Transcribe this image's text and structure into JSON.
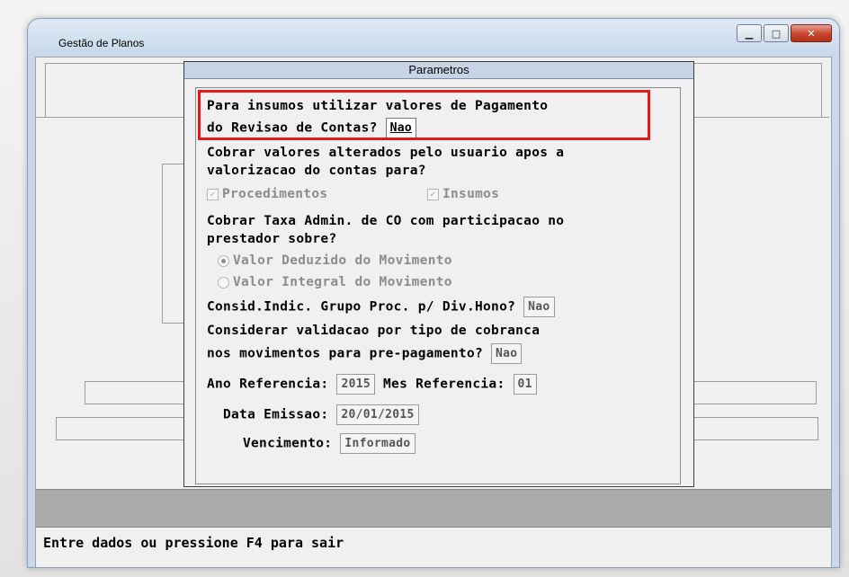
{
  "window": {
    "title": "Gestão de Planos"
  },
  "dialog": {
    "title": "Parametros",
    "q1_line1": "Para insumos utilizar valores de Pagamento",
    "q1_line2": "do Revisao de Contas?",
    "q1_value": "Nao",
    "q2_line1": "Cobrar valores alterados pelo usuario apos a",
    "q2_line2": "valorizacao do contas para?",
    "check_procedimentos": "Procedimentos",
    "check_insumos": "Insumos",
    "q3_line1": "Cobrar Taxa Admin. de CO com participacao no",
    "q3_line2": "prestador sobre?",
    "radio_deduzido": "Valor Deduzido do Movimento",
    "radio_integral": "Valor Integral do Movimento",
    "q4_label": "Consid.Indic. Grupo Proc. p/ Div.Hono?",
    "q4_value": "Nao",
    "q5_line1": "Considerar validacao por tipo de cobranca",
    "q5_line2": "nos movimentos para pre-pagamento?",
    "q5_value": "Nao",
    "ano_label": "Ano Referencia:",
    "ano_value": "2015",
    "mes_label": "Mes Referencia:",
    "mes_value": "01",
    "data_label": "Data Emissao:",
    "data_value": "20/01/2015",
    "venc_label": "Vencimento:",
    "venc_value": "Informado"
  },
  "status": {
    "text": "Entre dados ou pressione F4 para sair"
  },
  "colors": {
    "highlight": "#e01b1b"
  }
}
